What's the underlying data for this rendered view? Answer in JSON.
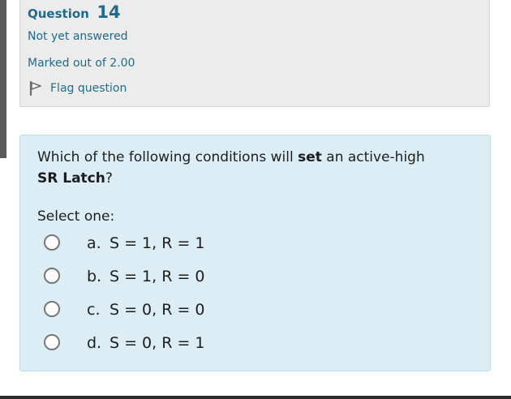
{
  "question": {
    "label": "Question",
    "number": "14",
    "state": "Not yet answered",
    "grade": "Marked out of 2.00",
    "flag_label": "Flag question"
  },
  "content": {
    "text_before": "Which of the following conditions will ",
    "text_bold_1": "set",
    "text_middle": " an active-high ",
    "text_bold_2": "SR Latch",
    "text_after": "?",
    "prompt": "Select one:"
  },
  "options": [
    {
      "letter": "a.",
      "text": "S = 1, R = 1"
    },
    {
      "letter": "b.",
      "text": "S = 1, R = 0"
    },
    {
      "letter": "c.",
      "text": "S = 0, R = 0"
    },
    {
      "letter": "d.",
      "text": "S = 0, R = 1"
    }
  ],
  "colors": {
    "link": "#1f6b8c",
    "info_bg": "#ececec",
    "question_bg": "#dcedf5"
  },
  "icons": {
    "flag": "flag-icon"
  }
}
